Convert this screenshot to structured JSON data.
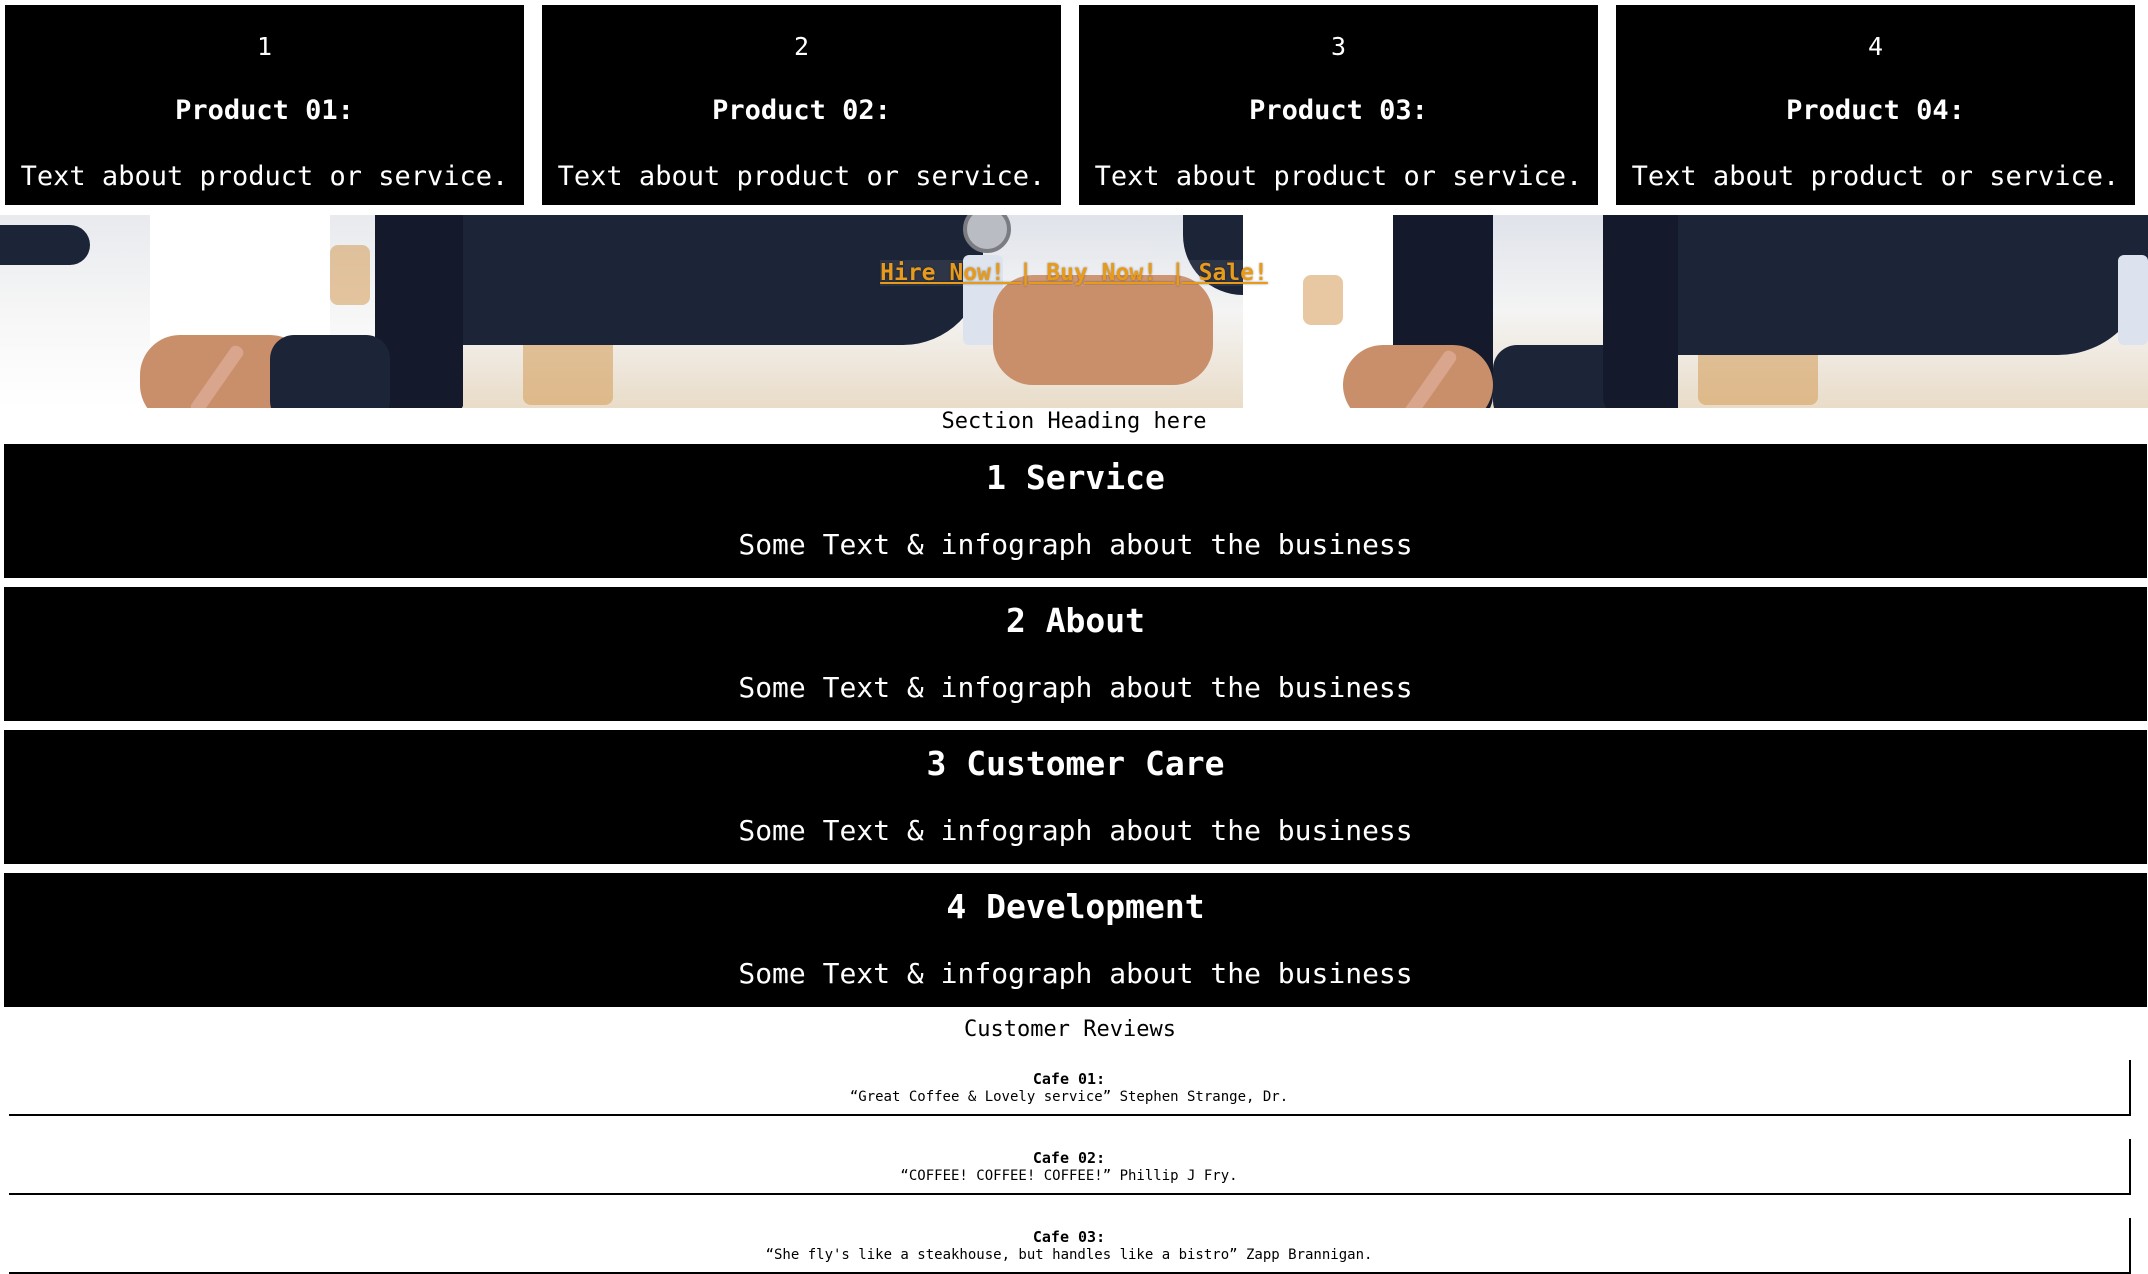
{
  "products": [
    {
      "number": "1",
      "name": "Product 01:",
      "text": "Text about product or service."
    },
    {
      "number": "2",
      "name": "Product 02:",
      "text": "Text about product or service."
    },
    {
      "number": "3",
      "name": "Product 03:",
      "text": "Text about product or service."
    },
    {
      "number": "4",
      "name": "Product 04:",
      "text": "Text about product or service."
    }
  ],
  "hero": {
    "link_text": "Hire Now! | Buy Now! | Sale!",
    "link_color": "#e89a1a"
  },
  "section_heading": "Section Heading here",
  "services": [
    {
      "title": "1 Service",
      "text": "Some Text & infograph about the business"
    },
    {
      "title": "2 About",
      "text": "Some Text & infograph about the business"
    },
    {
      "title": "3 Customer Care",
      "text": "Some Text & infograph about the business"
    },
    {
      "title": "4 Development",
      "text": "Some Text & infograph about the business"
    }
  ],
  "reviews": {
    "title": "Customer Reviews",
    "items": [
      {
        "name": "Cafe 01:",
        "quote": "“Great Coffee & Lovely service” Stephen Strange, Dr."
      },
      {
        "name": "Cafe 02:",
        "quote": "“COFFEE! COFFEE! COFFEE!” Phillip J Fry."
      },
      {
        "name": "Cafe 03:",
        "quote": "“She fly's like a steakhouse, but handles like a bistro” Zapp Brannigan."
      }
    ]
  }
}
